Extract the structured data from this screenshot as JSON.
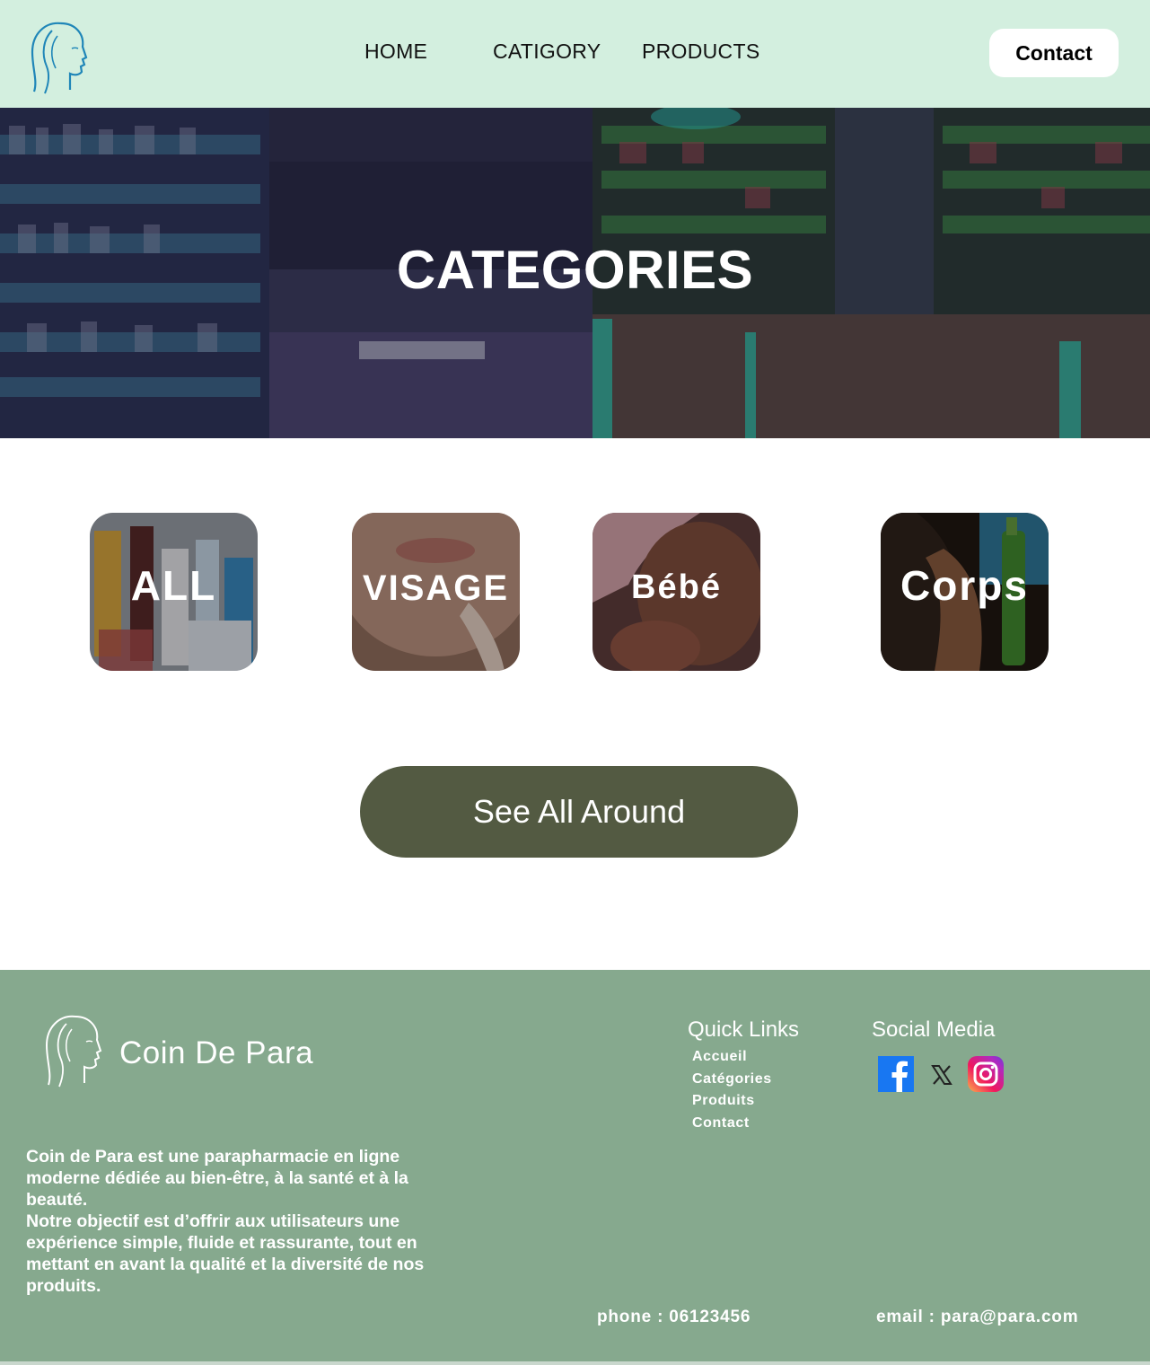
{
  "header": {
    "nav": [
      "HOME",
      "CATIGORY",
      "PRODUCTS"
    ],
    "contact_label": "Contact",
    "logo_icon": "woman-face-logo-icon"
  },
  "hero": {
    "title": "CATEGORIES"
  },
  "categories": [
    {
      "label": "ALL"
    },
    {
      "label": "VISAGE"
    },
    {
      "label": "Bébé"
    },
    {
      "label": "Corps"
    }
  ],
  "see_all_label": "See All Around",
  "footer": {
    "brand": "Coin De Para",
    "about": "Coin de Para est une parapharmacie en ligne moderne dédiée au bien-être, à la santé et à la beauté.\n Notre objectif est d’offrir aux utilisateurs une expérience simple, fluide et rassurante, tout en mettant en avant la qualité et la diversité de nos produits.",
    "quick_links_title": "Quick Links",
    "quick_links": [
      "Accueil",
      "Catégories",
      "Produits",
      "Contact"
    ],
    "social_title": "Social Media",
    "social_icons": [
      "facebook-icon",
      "x-icon",
      "instagram-icon"
    ],
    "phone": "phone : 06123456",
    "email": "email : para@para.com"
  },
  "colors": {
    "header_bg": "#d3efdf",
    "footer_bg": "#86a98e",
    "button_dark": "#535a42",
    "logo_blue": "#1f86b8"
  }
}
